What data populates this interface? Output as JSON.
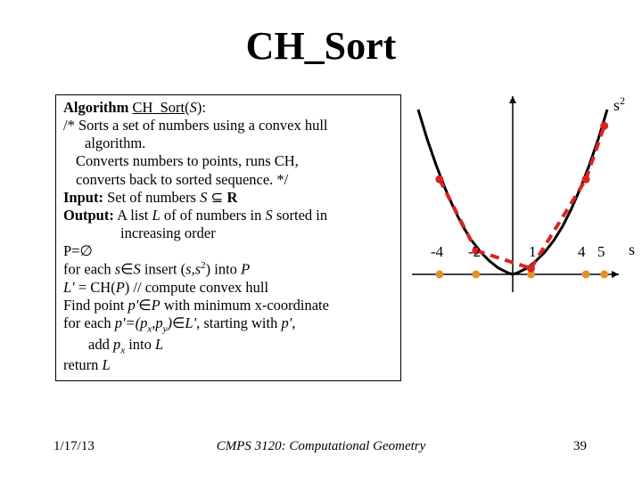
{
  "title": "CH_Sort",
  "algo": {
    "l1a": "Algorithm",
    "l1b": "CH_Sort",
    "l1c": "(",
    "l1d": "S",
    "l1e": "):",
    "l2": "/* Sorts a set of numbers using a convex hull",
    "l3": "algorithm.",
    "l4": "Converts numbers to points, runs CH,",
    "l5": "converts back to sorted sequence. */",
    "l6a": "Input:",
    "l6b": " Set of numbers ",
    "l6c": "S",
    "l6d": " ⊆ ",
    "l6e": "R",
    "l7a": "Output:",
    "l7b": " A list ",
    "l7c": "L",
    "l7d": " of of numbers in ",
    "l7e": "S",
    "l7f": " sorted in",
    "l8": "increasing order",
    "l9": "P=∅",
    "l10a": "for each ",
    "l10b": "s",
    "l10c": "∈",
    "l10d": "S",
    "l10e": " insert (",
    "l10f": "s",
    "l10g": ",",
    "l10h": "s",
    "l10i": "2",
    "l10j": ") into ",
    "l10k": "P",
    "l11a": "L'",
    "l11b": " = CH(",
    "l11c": "P",
    "l11d": ") // compute convex hull",
    "l12a": "Find point ",
    "l12b": "p'",
    "l12c": "∈",
    "l12d": "P",
    "l12e": " with minimum x-coordinate",
    "l13a": "for each ",
    "l13b": "p'=(p",
    "l13c": "x",
    "l13d": ",p",
    "l13e": "y",
    "l13f": ")",
    "l13g": "∈",
    "l13h": "L'",
    "l13i": ", starting with ",
    "l13j": "p'",
    "l13k": ",",
    "l14a": "add ",
    "l14b": "p",
    "l14c": "x",
    "l14d": " into ",
    "l14e": "L",
    "l15a": "return ",
    "l15b": "L"
  },
  "chart_data": {
    "type": "scatter",
    "title": "",
    "xlabel": "s",
    "ylabel": "s²",
    "x": [
      -4,
      -2,
      1,
      4,
      5
    ],
    "y": [
      16,
      4,
      1,
      16,
      25
    ],
    "xlim": [
      -5.5,
      5.8
    ],
    "ylim": [
      -3,
      30
    ],
    "tick_labels_x": [
      "-4",
      "-2",
      "1",
      "4",
      "5"
    ],
    "curve": "parabola y=x^2",
    "hull_edges": [
      [
        -4,
        16,
        -2,
        4
      ],
      [
        -2,
        4,
        1,
        1
      ],
      [
        1,
        1,
        4,
        16
      ],
      [
        4,
        16,
        5,
        25
      ]
    ]
  },
  "axis": {
    "y": "s",
    "ysup": "2",
    "x": "s",
    "ticks": {
      "m4": "-4",
      "m2": "-2",
      "p1": "1",
      "p4": "4",
      "p5": "5"
    }
  },
  "footer": {
    "date": "1/17/13",
    "course": "CMPS 3120: Computational Geometry",
    "page": "39"
  }
}
